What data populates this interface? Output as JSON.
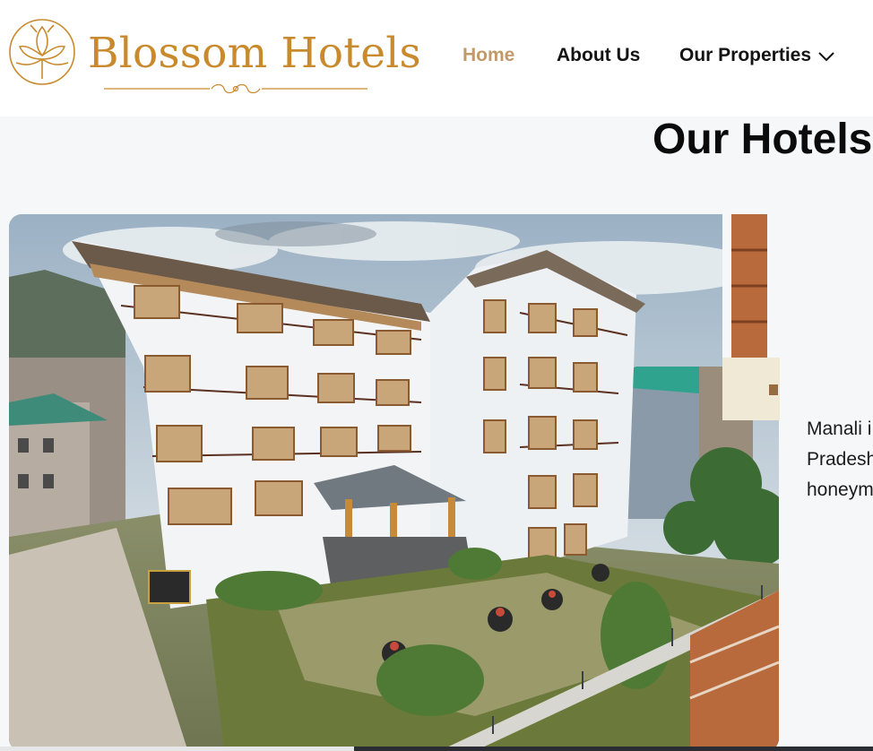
{
  "brand": {
    "name": "Blossom Hotels",
    "color": "#c98a2e",
    "logo_icon": "lotus-icon"
  },
  "nav": {
    "items": [
      {
        "label": "Home",
        "active": true
      },
      {
        "label": "About Us",
        "active": false
      },
      {
        "label": "Our Properties",
        "active": false,
        "icon": "chevron-down-icon"
      }
    ],
    "active_color": "#c29a69"
  },
  "section": {
    "title": "Our Hotels",
    "description_lines": [
      "Manali i",
      "Pradesh",
      "honeym"
    ]
  },
  "images": [
    {
      "name": "hotel-building-photo"
    },
    {
      "name": "wooden-balcony-photo"
    }
  ]
}
